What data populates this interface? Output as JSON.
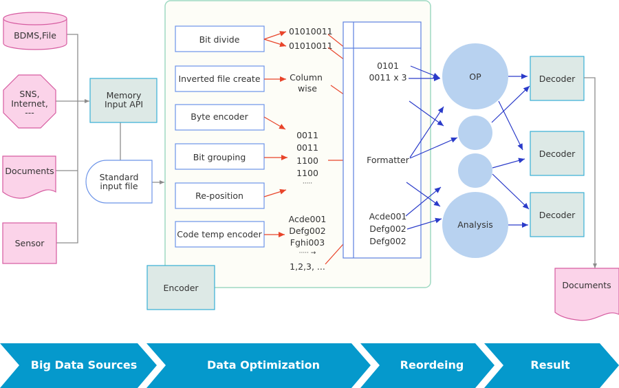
{
  "colors": {
    "source_fill": "#fbd3e9",
    "source_stroke": "#d65ba0",
    "teal_fill": "#dde9e6",
    "teal_stroke": "#35aed4",
    "step_stroke": "#6b93e8",
    "panel_fill": "#fdfdf7",
    "panel_stroke": "#9ed9c2",
    "circle_fill": "#b8d2f0",
    "red_arrow": "#e8442a",
    "blue_arrow": "#2a3bc9",
    "connector": "#8c8c8c",
    "banner": "#0599cc"
  },
  "sources": [
    {
      "label": "BDMS,File",
      "shape": "cylinder"
    },
    {
      "label_lines": [
        "SNS,",
        "Internet,",
        "---"
      ],
      "shape": "octagon"
    },
    {
      "label": "Documents",
      "shape": "document"
    },
    {
      "label": "Sensor",
      "shape": "rectangle"
    }
  ],
  "memory_input_api": {
    "label_lines": [
      "Memory",
      "Input API"
    ]
  },
  "standard_input_file": {
    "label_lines": [
      "Standard",
      "input file"
    ]
  },
  "encoder": {
    "label": "Encoder"
  },
  "steps": [
    {
      "label": "Bit divide"
    },
    {
      "label": "Inverted file create"
    },
    {
      "label": "Byte encoder"
    },
    {
      "label": "Bit grouping"
    },
    {
      "label": "Re-position"
    },
    {
      "label": "Code temp encoder"
    }
  ],
  "intermediate": {
    "bit_divide_out": [
      "01010011",
      "01010011"
    ],
    "column_wise": [
      "Column",
      "wise"
    ],
    "grouped_bits": [
      "0011",
      "0011",
      "1100",
      "1100",
      "·····"
    ],
    "codes": [
      "Acde001",
      "Defg002",
      "Fghi003",
      "····· →",
      "1,2,3, ..."
    ]
  },
  "table": {
    "bits": [
      "0101",
      "0011 x 3"
    ],
    "formatter": "Formatter",
    "codes": [
      "Acde001",
      "Defg002",
      "Defg002"
    ]
  },
  "reorder": {
    "op": "OP",
    "analysis": "Analysis"
  },
  "decoders": [
    {
      "label": "Decoder"
    },
    {
      "label": "Decoder"
    },
    {
      "label": "Decoder"
    }
  ],
  "output_document": {
    "label": "Documents"
  },
  "banner": [
    {
      "label": "Big Data Sources"
    },
    {
      "label": "Data Optimization"
    },
    {
      "label": "Reordeing"
    },
    {
      "label": "Result"
    }
  ]
}
